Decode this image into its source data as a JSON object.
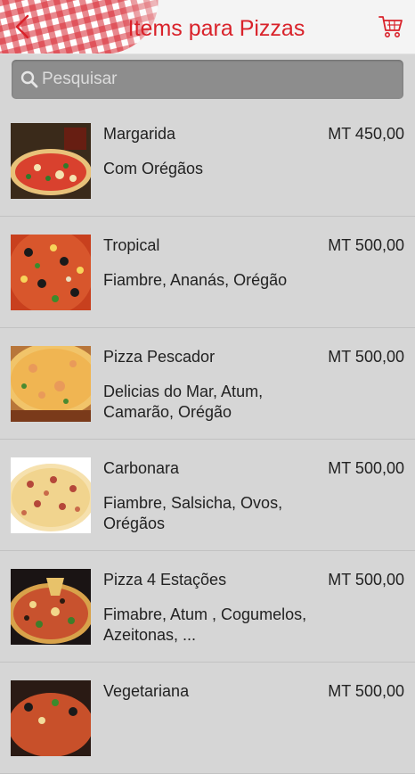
{
  "header": {
    "title": "Items para Pizzas",
    "back_icon": "chevron-left-icon",
    "cart_icon": "cart-icon",
    "accent_color": "#d9222a"
  },
  "search": {
    "placeholder": "Pesquisar",
    "icon": "search-icon"
  },
  "items": [
    {
      "name": "Margarida",
      "price": "MT 450,00",
      "desc": "Com Orégãos"
    },
    {
      "name": "Tropical",
      "price": "MT 500,00",
      "desc": "Fiambre, Ananás, Orégão"
    },
    {
      "name": "Pizza Pescador",
      "price": "MT 500,00",
      "desc": "Delicias do Mar, Atum, Camarão, Orégão"
    },
    {
      "name": "Carbonara",
      "price": "MT 500,00",
      "desc": "Fiambre, Salsicha, Ovos, Orégãos"
    },
    {
      "name": "Pizza 4 Estações",
      "price": "MT 500,00",
      "desc": "Fimabre, Atum , Cogumelos, Azeitonas, ..."
    },
    {
      "name": "Vegetariana",
      "price": "MT 500,00",
      "desc": ""
    }
  ]
}
